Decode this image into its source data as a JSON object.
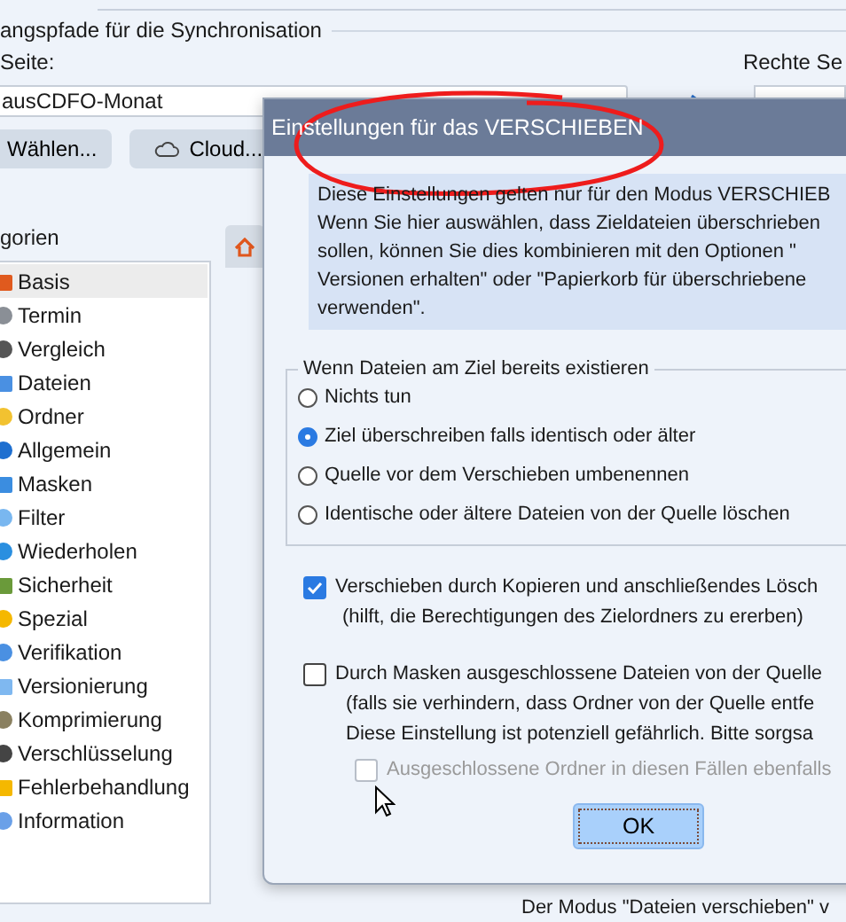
{
  "background": {
    "section_title": "angspfade für die Synchronisation",
    "left_label": "Seite:",
    "left_path": "ausCDFO-Monat",
    "right_label": "Rechte Se",
    "buttons": [
      {
        "label": "Wählen...",
        "kind": "plain"
      },
      {
        "label": "Cloud...",
        "kind": "cloud"
      }
    ],
    "categories_title": "gorien",
    "categories": [
      {
        "label": "Basis",
        "selected": true
      },
      {
        "label": "Termin",
        "selected": false
      },
      {
        "label": "Vergleich",
        "selected": false
      },
      {
        "label": "Dateien",
        "selected": false
      },
      {
        "label": "Ordner",
        "selected": false
      },
      {
        "label": "Allgemein",
        "selected": false
      },
      {
        "label": "Masken",
        "selected": false
      },
      {
        "label": "Filter",
        "selected": false
      },
      {
        "label": "Wiederholen",
        "selected": false
      },
      {
        "label": "Sicherheit",
        "selected": false
      },
      {
        "label": "Spezial",
        "selected": false
      },
      {
        "label": "Verifikation",
        "selected": false
      },
      {
        "label": "Versionierung",
        "selected": false
      },
      {
        "label": "Komprimierung",
        "selected": false
      },
      {
        "label": "Verschlüsselung",
        "selected": false
      },
      {
        "label": "Fehlerbehandlung",
        "selected": false
      },
      {
        "label": "Information",
        "selected": false
      }
    ],
    "footer_text": "Der Modus \"Dateien verschieben\" v"
  },
  "dialog": {
    "title": "Einstellungen für das VERSCHIEBEN",
    "info": "Diese Einstellungen gelten nur für den Modus VERSCHIEB\nWenn Sie hier auswählen, dass Zieldateien überschrieben\nsollen, können Sie dies kombinieren mit den Optionen \"\nVersionen erhalten\" oder \"Papierkorb für überschriebene\nverwenden\".",
    "group_title": "Wenn Dateien am Ziel bereits existieren",
    "radios": [
      {
        "label": "Nichts tun",
        "selected": false
      },
      {
        "label": "Ziel überschreiben falls identisch oder älter",
        "selected": true
      },
      {
        "label": "Quelle vor dem Verschieben umbenennen",
        "selected": false
      },
      {
        "label": "Identische oder ältere Dateien von der Quelle löschen",
        "selected": false
      }
    ],
    "options": [
      {
        "label": "Verschieben durch Kopieren und anschließendes Lösch",
        "checked": true,
        "disabled": false,
        "note": "(hilft, die Berechtigungen des Zielordners zu ererben)"
      },
      {
        "label": "Durch Masken ausgeschlossene Dateien von der Quelle",
        "checked": false,
        "disabled": false,
        "note": "(falls sie verhindern, dass Ordner von der Quelle entfe\nDiese Einstellung ist potenziell gefährlich. Bitte sorgsa"
      },
      {
        "label": "Ausgeschlossene Ordner in diesen Fällen ebenfalls",
        "checked": false,
        "disabled": true
      }
    ],
    "ok": "OK"
  }
}
